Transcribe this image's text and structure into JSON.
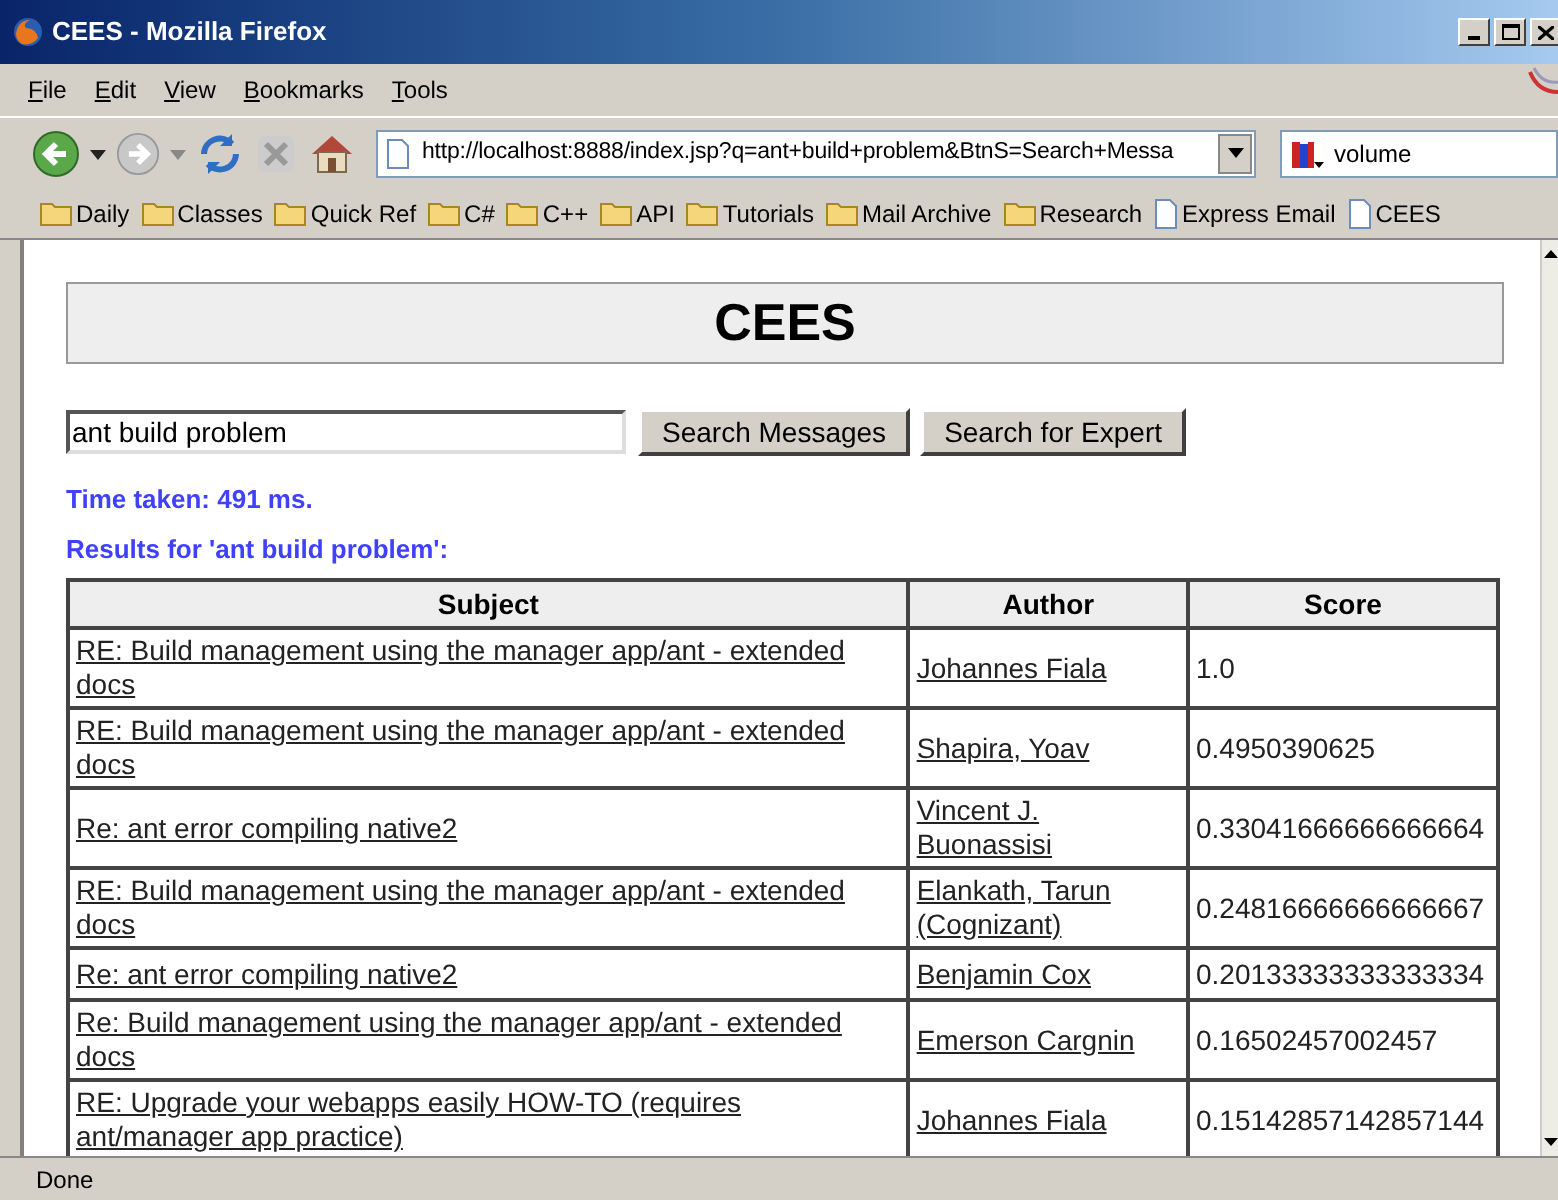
{
  "window": {
    "title": "CEES - Mozilla Firefox"
  },
  "menu": [
    "File",
    "Edit",
    "View",
    "Bookmarks",
    "Tools"
  ],
  "toolbar": {
    "url": "http://localhost:8888/index.jsp?q=ant+build+problem&BtnS=Search+Messa",
    "search_value": "volume"
  },
  "bookmarks": [
    {
      "kind": "folder",
      "label": "Daily"
    },
    {
      "kind": "folder",
      "label": "Classes"
    },
    {
      "kind": "folder",
      "label": "Quick Ref"
    },
    {
      "kind": "folder",
      "label": "C#"
    },
    {
      "kind": "folder",
      "label": "C++"
    },
    {
      "kind": "folder",
      "label": "API"
    },
    {
      "kind": "folder",
      "label": "Tutorials"
    },
    {
      "kind": "folder",
      "label": "Mail Archive"
    },
    {
      "kind": "folder",
      "label": "Research"
    },
    {
      "kind": "page",
      "label": "Express Email"
    },
    {
      "kind": "page",
      "label": "CEES"
    }
  ],
  "page": {
    "heading": "CEES",
    "query": "ant build problem",
    "buttons": [
      "Search Messages",
      "Search for Expert"
    ],
    "time_taken": "Time taken: 491 ms.",
    "results_for": "Results for 'ant build problem':",
    "table": {
      "columns": [
        "Subject",
        "Author",
        "Score"
      ],
      "rows": [
        [
          "RE: Build management using the manager app/ant - extended docs",
          "Johannes Fiala",
          "1.0"
        ],
        [
          "RE: Build management using the manager app/ant - extended docs",
          "Shapira, Yoav",
          "0.4950390625"
        ],
        [
          "Re: ant error compiling native2",
          "Vincent J. Buonassisi",
          "0.33041666666666664"
        ],
        [
          "RE: Build management using the manager app/ant - extended docs",
          "Elankath, Tarun (Cognizant)",
          "0.24816666666666667"
        ],
        [
          "Re: ant error compiling native2",
          "Benjamin Cox",
          "0.20133333333333334"
        ],
        [
          "Re: Build management using the manager app/ant - extended docs",
          "Emerson Cargnin",
          "0.16502457002457"
        ],
        [
          "RE: Upgrade your webapps easily HOW-TO (requires ant/manager app practice)",
          "Johannes Fiala",
          "0.15142857142857144"
        ]
      ]
    }
  },
  "status_bar": "Done"
}
